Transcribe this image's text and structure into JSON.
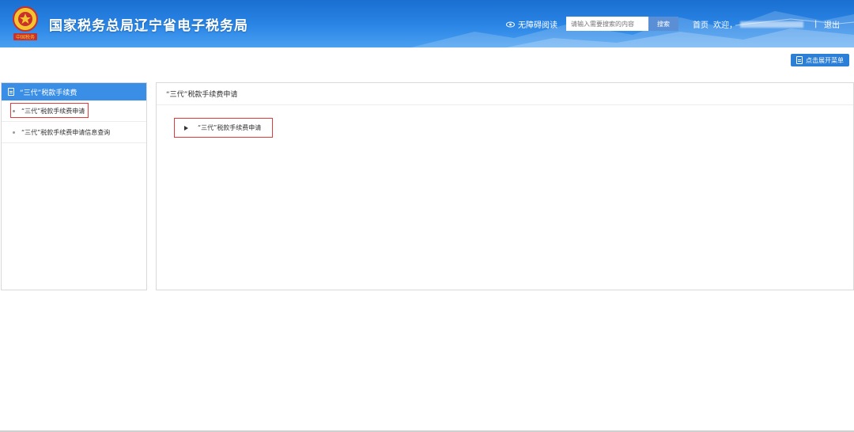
{
  "header": {
    "site_title": "国家税务总局辽宁省电子税务局",
    "emblem_text": "中国税务",
    "accessibility_label": "无障碍阅读",
    "search": {
      "placeholder": "请输入需要搜索的内容",
      "button_label": "搜索"
    },
    "nav": {
      "home": "首页",
      "welcome": "欢迎，",
      "separator": "|",
      "logout": "退出"
    }
  },
  "toolbar": {
    "expand_menu_label": "点击展开菜单"
  },
  "sidebar": {
    "title": "“三代”税款手续费",
    "items": [
      {
        "label": "“三代”税款手续费申请",
        "active": true
      },
      {
        "label": "“三代”税款手续费申请信息查询",
        "active": false
      }
    ]
  },
  "main": {
    "title": "“三代”税款手续费申请",
    "link_label": "“三代”税款手续费申请"
  },
  "colors": {
    "header": "#2b86e6",
    "accent": "#3a8ee6",
    "highlight": "#e03a3a"
  }
}
